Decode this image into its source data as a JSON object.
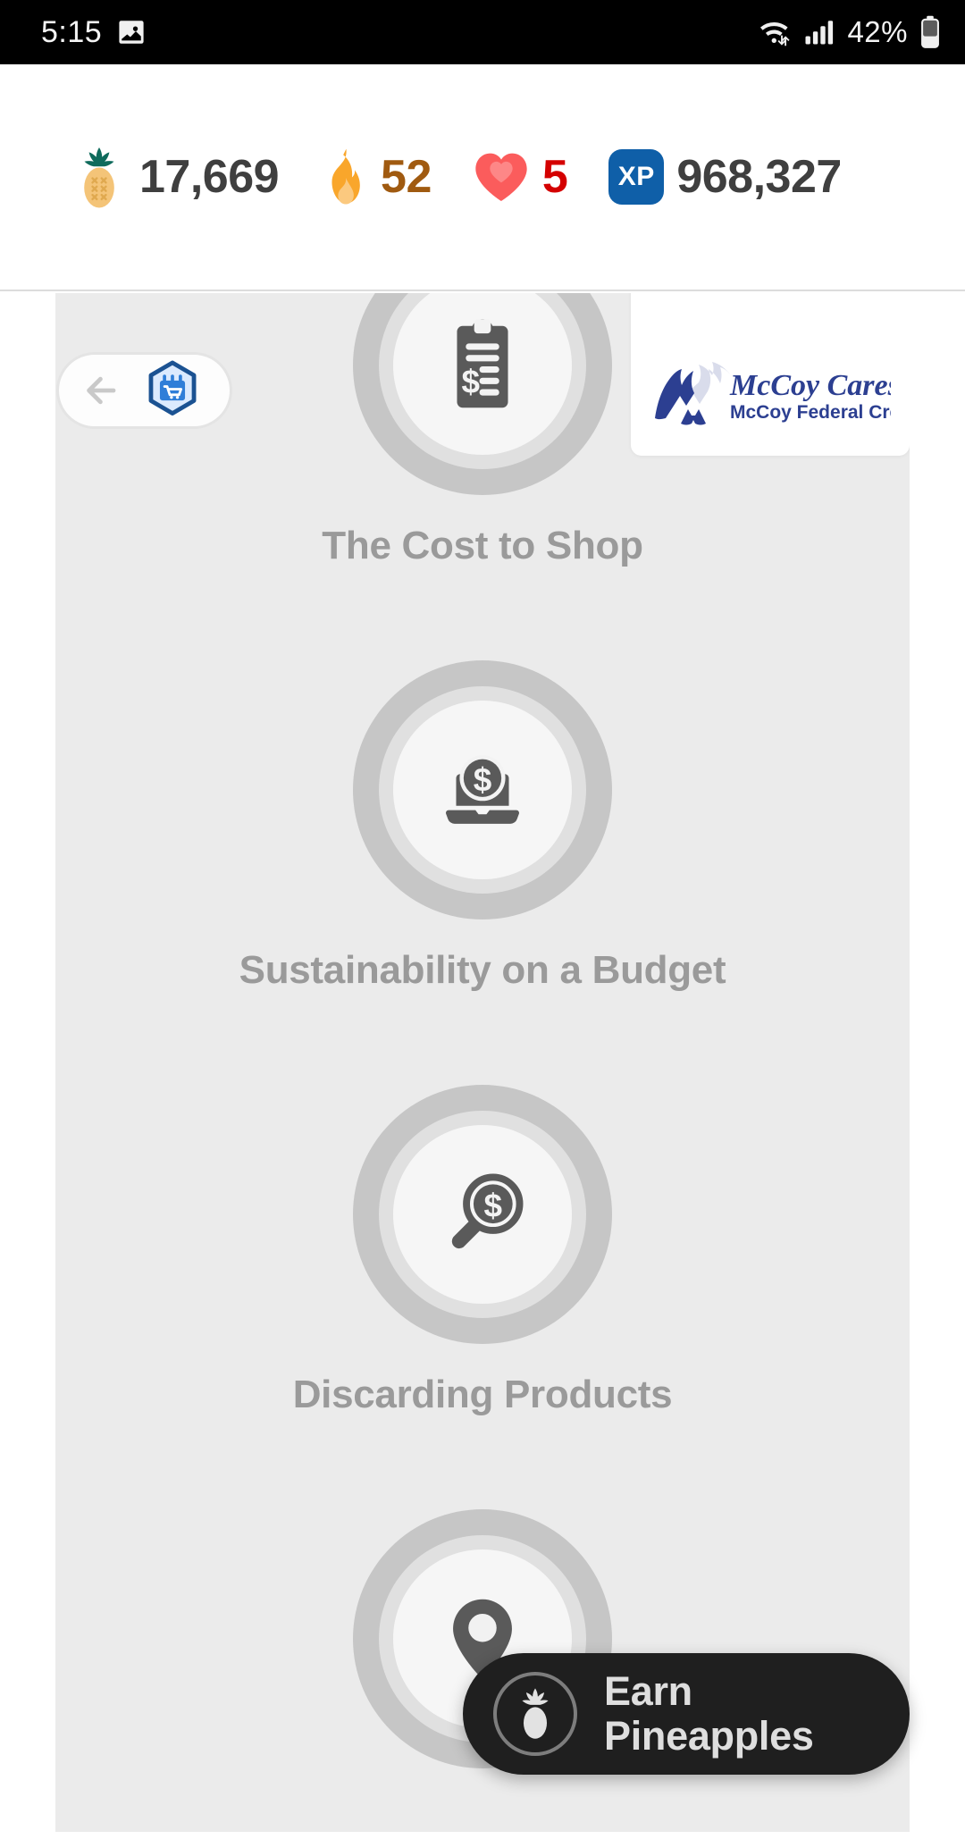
{
  "status_bar": {
    "time": "5:15",
    "gallery_icon": "image-icon",
    "wifi_icon": "wifi-data-icon",
    "signal_icon": "cellular-signal-icon",
    "battery_percent": "42%",
    "battery_icon": "battery-icon"
  },
  "stats": {
    "pineapple": {
      "icon": "pineapple-icon",
      "value": "17,669",
      "color": "#3f3f3f"
    },
    "streak": {
      "icon": "fire-icon",
      "value": "52",
      "color": "#a05a10"
    },
    "lives": {
      "icon": "heart-icon",
      "value": "5",
      "color": "#d40000"
    },
    "xp": {
      "icon": "xp-badge-icon",
      "badge_label": "XP",
      "value": "968,327",
      "color": "#3f3f3f",
      "badge_color": "#0f5fa8"
    }
  },
  "nav": {
    "back_icon": "back-arrow-icon",
    "course_badge_icon": "shopping-calendar-hex-icon"
  },
  "sponsor": {
    "icon": "mccoy-mountain-logo-icon",
    "title": "McCoy Cares",
    "subtitle": "McCoy Federal Credit Union",
    "color": "#2c3f91"
  },
  "modules": [
    {
      "icon": "clipboard-dollar-icon",
      "label": "The Cost to Shop"
    },
    {
      "icon": "laptop-dollar-icon",
      "label": "Sustainability on a Budget"
    },
    {
      "icon": "magnifier-dollar-icon",
      "label": "Discarding Products"
    },
    {
      "icon": "location-pin-dollar-icon",
      "label": ""
    }
  ],
  "earn_button": {
    "icon": "pineapple-outline-icon",
    "line1": "Earn",
    "line2": "Pineapples",
    "background": "#1f1f1f"
  }
}
